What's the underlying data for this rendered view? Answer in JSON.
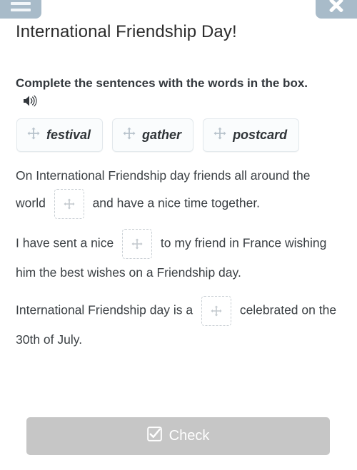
{
  "header": {
    "menu_icon": "hamburger-menu-icon",
    "close_icon": "close-icon",
    "title": "International Friendship Day!"
  },
  "instruction": {
    "text": "Complete the sentences with the words in the box.",
    "audio_icon": "speaker-icon"
  },
  "word_bank": {
    "drag_icon": "move-arrows-icon",
    "chips": [
      {
        "label": "festival"
      },
      {
        "label": "gather"
      },
      {
        "label": "postcard"
      }
    ]
  },
  "sentences": [
    {
      "before": "On International Friendship day friends all around the world",
      "drop_icon": "move-arrows-icon",
      "after": "and have a nice time together."
    },
    {
      "before": "I have sent a nice",
      "drop_icon": "move-arrows-icon",
      "after": "to my friend in France wishing him the best wishes on a Friendship day."
    },
    {
      "before": "International Friendship day is a",
      "drop_icon": "move-arrows-icon",
      "after": " celebrated on the 30th of July."
    }
  ],
  "footer": {
    "check_label": "Check",
    "check_icon": "checkbox-checked-icon"
  },
  "colors": {
    "chrome_button": "#a8bbc9",
    "check_button_disabled": "#c6c6c6",
    "text": "#3a3f43",
    "chip_border": "#e2e8ec"
  }
}
